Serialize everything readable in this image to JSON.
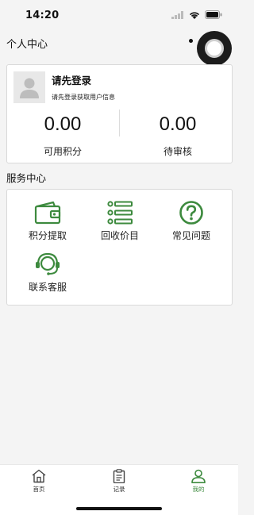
{
  "status_bar": {
    "time": "14:20"
  },
  "nav": {
    "title": "个人中心"
  },
  "user": {
    "login_title": "请先登录",
    "login_subtitle": "请先登录获取用户信息",
    "points_value": "0.00",
    "points_label": "可用积分",
    "pending_value": "0.00",
    "pending_label": "待审核"
  },
  "services": {
    "title": "服务中心",
    "items": [
      {
        "label": "积分提取",
        "icon": "wallet-icon"
      },
      {
        "label": "回收价目",
        "icon": "list-icon"
      },
      {
        "label": "常见问题",
        "icon": "question-icon"
      },
      {
        "label": "联系客服",
        "icon": "headset-icon"
      }
    ]
  },
  "tabs": [
    {
      "label": "首页",
      "icon": "home-icon",
      "active": false
    },
    {
      "label": "记录",
      "icon": "clipboard-icon",
      "active": false
    },
    {
      "label": "我的",
      "icon": "user-icon",
      "active": true
    }
  ],
  "colors": {
    "accent": "#3d8a3e",
    "background": "#f4f4f4",
    "card": "#ffffff"
  }
}
